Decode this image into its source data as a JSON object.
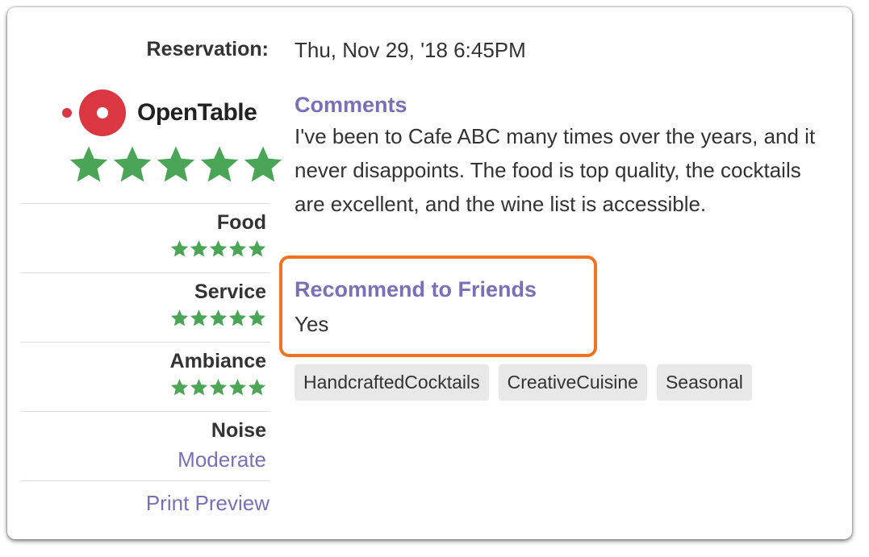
{
  "reservation": {
    "label": "Reservation:",
    "value": "Thu, Nov 29, '18 6:45PM"
  },
  "brand": {
    "logo_text": "OpenTable",
    "logo_color": "#da3743"
  },
  "overall_rating": {
    "value": 5,
    "max": 5
  },
  "ratings": [
    {
      "label": "Food",
      "value": 5,
      "max": 5
    },
    {
      "label": "Service",
      "value": 5,
      "max": 5
    },
    {
      "label": "Ambiance",
      "value": 5,
      "max": 5
    }
  ],
  "noise": {
    "label": "Noise",
    "value": "Moderate"
  },
  "print_preview": "Print Preview",
  "comments": {
    "heading": "Comments",
    "text": "I've been to Cafe ABC many times over the years, and it never disappoints. The food is top quality, the cocktails are excellent, and the wine list is accessible."
  },
  "recommend": {
    "heading": "Recommend to Friends",
    "value": "Yes"
  },
  "tags": [
    "HandcraftedCocktails",
    "CreativeCuisine",
    "Seasonal"
  ],
  "colors": {
    "star": "#4aa557",
    "accent": "#7b6fb9",
    "highlight": "#f07222"
  }
}
